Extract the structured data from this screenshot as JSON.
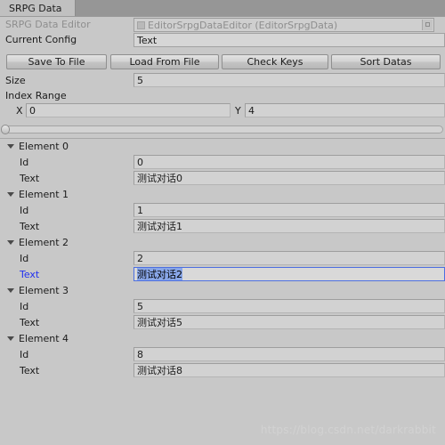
{
  "window": {
    "tab_label": "SRPG Data"
  },
  "header": {
    "editor_label": "SRPG Data Editor",
    "editor_object": "EditorSrpgDataEditor (EditorSrpgData)",
    "object_icon": "script-icon",
    "picker_icon": "object-picker-icon",
    "current_config_label": "Current Config",
    "current_config_value": "Text"
  },
  "toolbar": {
    "save_to_file": "Save To File",
    "load_from_file": "Load From File",
    "check_keys": "Check Keys",
    "sort_datas": "Sort Datas"
  },
  "size": {
    "label": "Size",
    "value": "5"
  },
  "index_range": {
    "label": "Index Range",
    "x_label": "X",
    "x_value": "0",
    "y_label": "Y",
    "y_value": "4",
    "slider_min": 0,
    "slider_max": 4,
    "slider_range_min": 0,
    "slider_range_max": 200
  },
  "elements": [
    {
      "foldout_label": "Element 0",
      "expanded": true,
      "id_label": "Id",
      "id_value": "0",
      "text_label": "Text",
      "text_value": "测试对话0",
      "focused": false
    },
    {
      "foldout_label": "Element 1",
      "expanded": true,
      "id_label": "Id",
      "id_value": "1",
      "text_label": "Text",
      "text_value": "测试对话1",
      "focused": false
    },
    {
      "foldout_label": "Element 2",
      "expanded": true,
      "id_label": "Id",
      "id_value": "2",
      "text_label": "Text",
      "text_value": "测试对话2",
      "focused": true
    },
    {
      "foldout_label": "Element 3",
      "expanded": true,
      "id_label": "Id",
      "id_value": "5",
      "text_label": "Text",
      "text_value": "测试对话5",
      "focused": false
    },
    {
      "foldout_label": "Element 4",
      "expanded": true,
      "id_label": "Id",
      "id_value": "8",
      "text_label": "Text",
      "text_value": "测试对话8",
      "focused": false
    }
  ],
  "watermark": "https://blog.csdn.net/darkrabbit",
  "colors": {
    "panel_bg": "#c8c8c8",
    "tabbar_bg": "#969696",
    "tab_bg": "#c0c0c0",
    "field_bg": "#d6d6d6",
    "focus_blue": "#2030f0",
    "selection_blue": "#88a6e8",
    "dim_text": "#8e8e8e"
  }
}
